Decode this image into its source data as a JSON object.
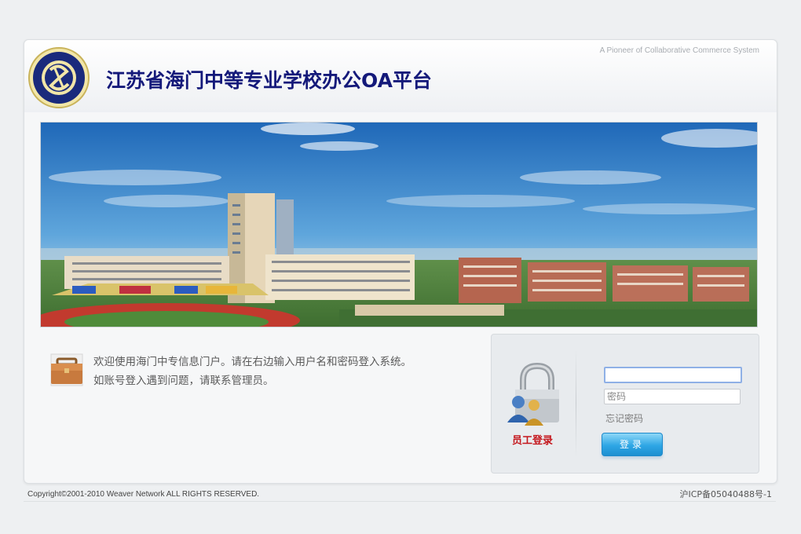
{
  "header": {
    "tagline": "A Pioneer of Collaborative Commerce System",
    "title": "江苏省海门中等专业学校办公OA平台"
  },
  "welcome": {
    "line1": "欢迎使用海门中专信息门户。请在右边输入用户名和密码登入系统。",
    "line2": "如账号登入遇到问题，请联系管理员。"
  },
  "login": {
    "staff_label": "员工登录",
    "username_value": "",
    "password_placeholder": "密码",
    "forgot_label": "忘记密码",
    "button_label": "登录"
  },
  "footer": {
    "copyright": "Copyright©2001-2010 Weaver Network ALL RIGHTS RESERVED.",
    "icp": "沪ICP备05040488号-1"
  },
  "colors": {
    "title": "#14197a",
    "staff_label": "#c4161c",
    "button": "#2ea6e5"
  }
}
